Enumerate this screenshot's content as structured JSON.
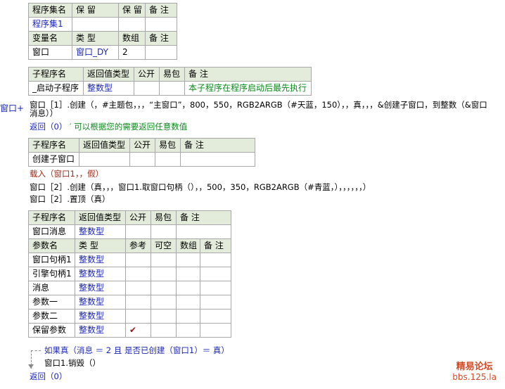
{
  "t1": {
    "h1": [
      "程序集名",
      "保 留",
      "保 留",
      "备 注"
    ],
    "r1": [
      "程序集1",
      "",
      "",
      ""
    ],
    "h2": [
      "变量名",
      "类 型",
      "数组",
      "备 注"
    ],
    "r2": [
      "窗口",
      "窗口_DY",
      "2",
      ""
    ]
  },
  "t2": {
    "h": [
      "子程序名",
      "返回值类型",
      "公开",
      "易包",
      "备 注"
    ],
    "r": [
      "_启动子程序",
      "整数型",
      "",
      "",
      "本子程序在程序启动后最先执行"
    ]
  },
  "marker": "窗口+",
  "code1": {
    "line1": "窗口［1］.创建（，#主题包，，，“主窗口”，800，550，RGB2ARGB（#天蓝，150），，真，，，&创建子窗口，到整数（&窗口",
    "line1b": "消息））",
    "line2_kw": "返回（0）",
    "line2_cmt": "′ 可以根据您的需要返回任意数值"
  },
  "t3": {
    "h": [
      "子程序名",
      "返回值类型",
      "公开",
      "易包",
      "备 注"
    ],
    "r": [
      "创建子窗口",
      "",
      "",
      "",
      ""
    ]
  },
  "code2": {
    "line1": "载入（窗口1，，假）",
    "line2": "窗口［2］.创建（真，，，窗口1.取窗口句柄（），，500，350，RGB2ARGB（#青蓝，），，，，，，）",
    "line3": "窗口［2］.置顶（真）"
  },
  "t4": {
    "h1": [
      "子程序名",
      "返回值类型",
      "公开",
      "易包",
      "备 注"
    ],
    "r1": [
      "窗口消息",
      "整数型",
      "",
      "",
      ""
    ],
    "h2": [
      "参数名",
      "类 型",
      "参考",
      "可空",
      "数组",
      "备 注"
    ],
    "params": [
      [
        "窗口句柄1",
        "整数型",
        ""
      ],
      [
        "引擎句柄1",
        "整数型",
        ""
      ],
      [
        "消息",
        "整数型",
        ""
      ],
      [
        "参数一",
        "整数型",
        ""
      ],
      [
        "参数二",
        "整数型",
        ""
      ],
      [
        "保留参数",
        "整数型",
        "✔"
      ]
    ]
  },
  "code3": {
    "line1": "如果真（消息 ＝ 2 且 是否已创建（窗口1）＝ 真）",
    "line2": "窗口1.销毁（）",
    "line3": "返回（0）"
  },
  "watermark": {
    "line1": "精易论坛",
    "line2": "bbs.125.la"
  }
}
